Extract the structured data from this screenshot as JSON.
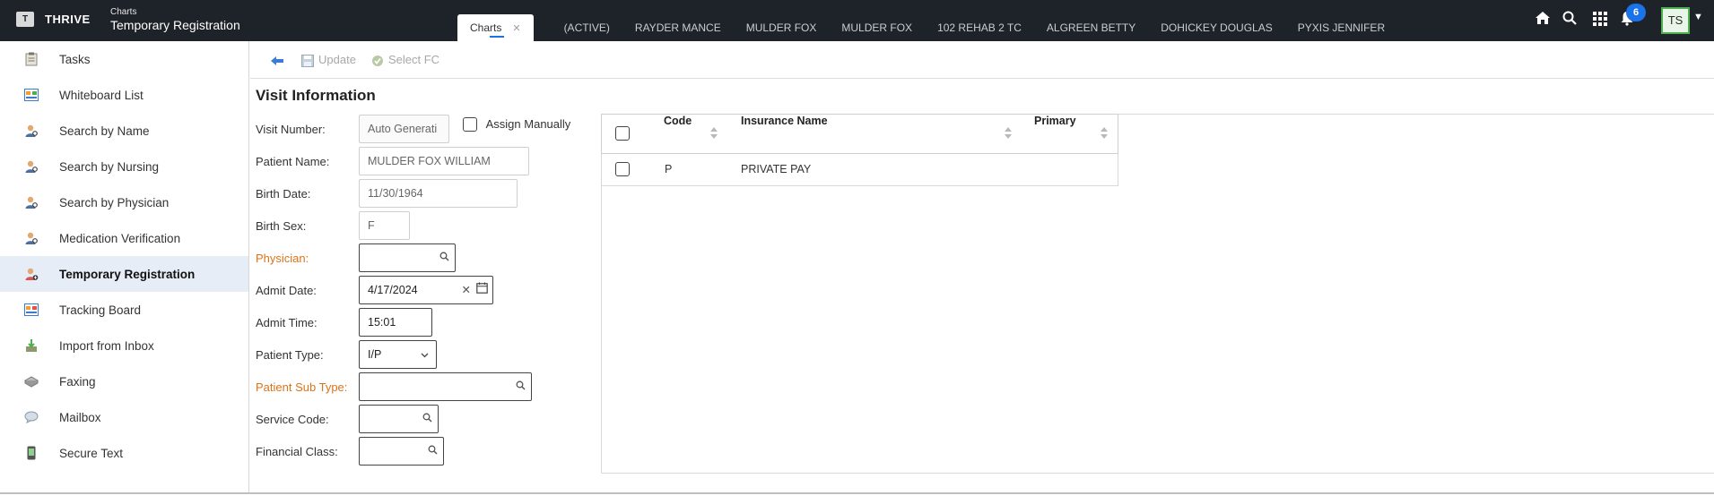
{
  "app": {
    "logo_letter": "T",
    "brand": "THRIVE",
    "breadcrumb_parent": "Charts",
    "breadcrumb_title": "Temporary Registration"
  },
  "tabs": [
    {
      "label": "Charts",
      "active": true
    },
    {
      "label": "(ACTIVE)"
    },
    {
      "label": "RAYDER MANCE"
    },
    {
      "label": "MULDER FOX"
    },
    {
      "label": "MULDER FOX"
    },
    {
      "label": "102 REHAB 2 TC"
    },
    {
      "label": "ALGREEN BETTY"
    },
    {
      "label": "DOHICKEY DOUGLAS"
    },
    {
      "label": "PYXIS JENNIFER"
    }
  ],
  "header_icons": [
    "home-icon",
    "search-icon",
    "apps-grid-icon",
    "bell-icon"
  ],
  "notifications_count": "6",
  "user_initials": "TS",
  "sidebar": {
    "items": [
      {
        "label": "Tasks",
        "icon": "tasks-icon"
      },
      {
        "label": "Whiteboard List",
        "icon": "whiteboard-icon"
      },
      {
        "label": "Search by Name",
        "icon": "person-search-icon"
      },
      {
        "label": "Search by Nursing",
        "icon": "person-search-icon"
      },
      {
        "label": "Search by Physician",
        "icon": "person-search-icon"
      },
      {
        "label": "Medication Verification",
        "icon": "person-search-icon"
      },
      {
        "label": "Temporary Registration",
        "icon": "person-add-icon",
        "active": true
      },
      {
        "label": "Tracking Board",
        "icon": "tracking-board-icon"
      },
      {
        "label": "Import from Inbox",
        "icon": "import-icon"
      },
      {
        "label": "Faxing",
        "icon": "fax-icon"
      },
      {
        "label": "Mailbox",
        "icon": "mailbox-icon"
      },
      {
        "label": "Secure Text",
        "icon": "phone-icon"
      }
    ]
  },
  "toolbar": {
    "update_label": "Update",
    "select_fc_label": "Select FC"
  },
  "visit": {
    "section_title": "Visit Information",
    "visit_number_label": "Visit Number:",
    "visit_number_value": "Auto Generati",
    "assign_manually_label": "Assign Manually",
    "patient_name_label": "Patient Name:",
    "patient_name_value": "MULDER FOX WILLIAM",
    "birth_date_label": "Birth Date:",
    "birth_date_value": "11/30/1964",
    "birth_sex_label": "Birth Sex:",
    "birth_sex_value": "F",
    "physician_label": "Physician:",
    "physician_value": "",
    "admit_date_label": "Admit Date:",
    "admit_date_value": "4/17/2024",
    "admit_time_label": "Admit Time:",
    "admit_time_value": "15:01",
    "patient_type_label": "Patient Type:",
    "patient_type_value": "I/P",
    "patient_sub_type_label": "Patient Sub Type:",
    "patient_sub_type_value": "",
    "service_code_label": "Service Code:",
    "service_code_value": "",
    "financial_class_label": "Financial Class:",
    "financial_class_value": ""
  },
  "insurance_grid": {
    "columns": [
      "Code",
      "Insurance Name",
      "Primary"
    ],
    "rows": [
      {
        "code": "P",
        "insurance_name": "PRIVATE PAY",
        "primary": ""
      }
    ]
  },
  "colors": {
    "topbar": "#1e2329",
    "accent": "#1a73e8",
    "required_label": "#d9741b",
    "active_sidebar": "#e6edf6"
  }
}
